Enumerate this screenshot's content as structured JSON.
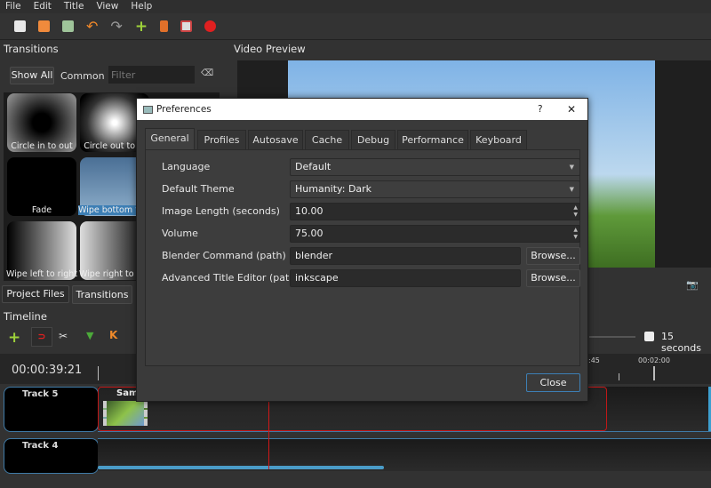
{
  "menu": [
    "File",
    "Edit",
    "Title",
    "View",
    "Help"
  ],
  "toolbar_icons": [
    "new-project-icon",
    "open-project-icon",
    "save-project-icon",
    "undo-icon",
    "redo-icon",
    "import-files-icon",
    "choose-profile-icon",
    "fullscreen-icon",
    "export-video-icon"
  ],
  "transitions": {
    "title": "Transitions",
    "show_all": "Show All",
    "common": "Common",
    "filter_placeholder": "Filter",
    "items": [
      "Circle in to out",
      "Circle out to in",
      "Fade",
      "Wipe bottom to top",
      "Wipe left to right",
      "Wipe right to left"
    ],
    "selected_index": 3
  },
  "bottom_tabs": [
    "Project Files",
    "Transitions"
  ],
  "video_preview": {
    "title": "Video Preview"
  },
  "timeline": {
    "title": "Timeline",
    "timecode": "00:00:39:21",
    "zoom_label": "15 seconds",
    "ruler": [
      ":45",
      "00:02:00"
    ],
    "tracks": [
      {
        "name": "Track 5",
        "clip": "Samp"
      },
      {
        "name": "Track 4"
      }
    ]
  },
  "dialog": {
    "title": "Preferences",
    "help": "?",
    "close_x": "✕",
    "tabs": [
      "General",
      "Profiles",
      "Autosave",
      "Cache",
      "Debug",
      "Performance",
      "Keyboard"
    ],
    "active_tab": 0,
    "rows": [
      {
        "label": "Language",
        "value": "Default"
      },
      {
        "label": "Default Theme",
        "value": "Humanity: Dark"
      },
      {
        "label": "Image Length (seconds)",
        "value": "10.00"
      },
      {
        "label": "Volume",
        "value": "75.00"
      },
      {
        "label": "Blender Command (path)",
        "value": "blender",
        "button": "Browse..."
      },
      {
        "label": "Advanced Title Editor (path)",
        "value": "inkscape",
        "button": "Browse..."
      }
    ],
    "close_button": "Close"
  },
  "colors": {
    "accent": "#3d7fb5",
    "record": "#e02020",
    "playhead": "#d01818"
  }
}
